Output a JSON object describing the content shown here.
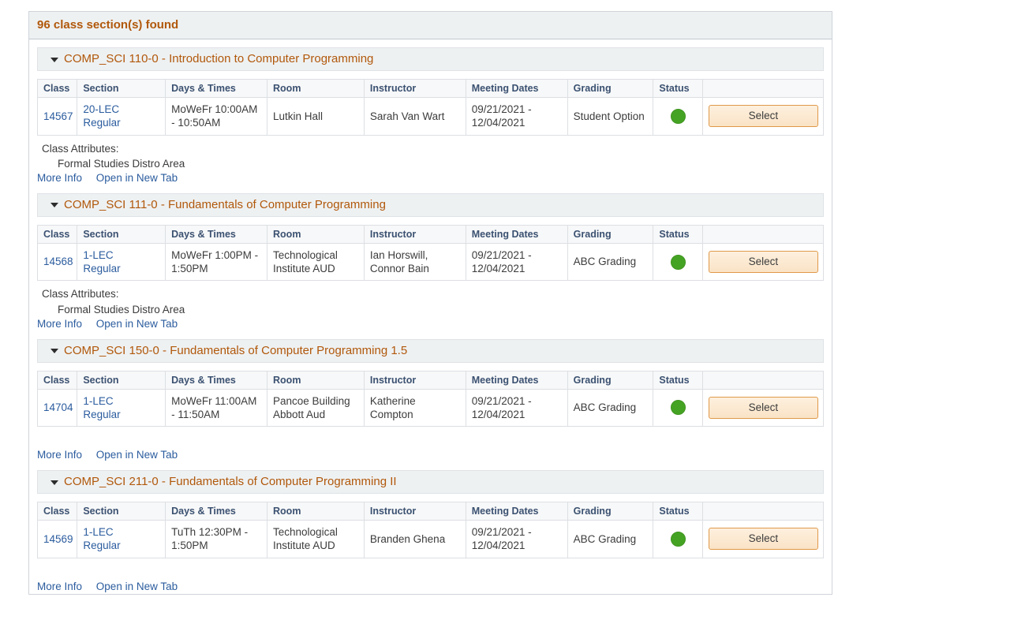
{
  "results": {
    "found_label": "96 class section(s) found",
    "columns": [
      "Class",
      "Section",
      "Days & Times",
      "Room",
      "Instructor",
      "Meeting Dates",
      "Grading",
      "Status",
      ""
    ],
    "select_label": "Select",
    "more_info_label": "More Info",
    "open_new_tab_label": "Open in New Tab",
    "attributes_label": "Class Attributes:",
    "status_icon": "green-circle-icon",
    "caret_icon": "caret-down-icon",
    "colors": {
      "header_text": "#b1580b",
      "link": "#2b5c9e",
      "status_open": "#45a324",
      "button_border": "#e0994a",
      "column_header_text": "#3b5171"
    },
    "groups": [
      {
        "title": "COMP_SCI 110-0 - Introduction to Computer Programming",
        "attributes_label": "Class Attributes:",
        "attributes_value": "Formal Studies Distro Area",
        "has_attributes": true,
        "row": {
          "class_nbr": "14567",
          "section_line1": "20-LEC",
          "section_line2": "Regular",
          "days_times": "MoWeFr 10:00AM - 10:50AM",
          "room": "Lutkin Hall",
          "instructor": "Sarah Van Wart",
          "meeting_dates": "09/21/2021 - 12/04/2021",
          "grading": "Student Option",
          "status": "Open"
        }
      },
      {
        "title": "COMP_SCI 111-0 - Fundamentals of Computer Programming",
        "attributes_label": "Class Attributes:",
        "attributes_value": "Formal Studies Distro Area",
        "has_attributes": true,
        "row": {
          "class_nbr": "14568",
          "section_line1": "1-LEC",
          "section_line2": "Regular",
          "days_times": "MoWeFr 1:00PM - 1:50PM",
          "room": "Technological Institute AUD",
          "instructor": "Ian Horswill, Connor Bain",
          "meeting_dates": "09/21/2021 - 12/04/2021",
          "grading": "ABC Grading",
          "status": "Open"
        }
      },
      {
        "title": "COMP_SCI 150-0 - Fundamentals of Computer Programming 1.5",
        "attributes_label": "",
        "attributes_value": "",
        "has_attributes": false,
        "row": {
          "class_nbr": "14704",
          "section_line1": "1-LEC",
          "section_line2": "Regular",
          "days_times": "MoWeFr 11:00AM - 11:50AM",
          "room": "Pancoe Building Abbott Aud",
          "instructor": "Katherine Compton",
          "meeting_dates": "09/21/2021 - 12/04/2021",
          "grading": "ABC Grading",
          "status": "Open"
        }
      },
      {
        "title": "COMP_SCI 211-0 - Fundamentals of Computer Programming II",
        "attributes_label": "",
        "attributes_value": "",
        "has_attributes": false,
        "row": {
          "class_nbr": "14569",
          "section_line1": "1-LEC",
          "section_line2": "Regular",
          "days_times": "TuTh 12:30PM - 1:50PM",
          "room": "Technological Institute AUD",
          "instructor": "Branden Ghena",
          "meeting_dates": "09/21/2021 - 12/04/2021",
          "grading": "ABC Grading",
          "status": "Open"
        }
      }
    ]
  }
}
